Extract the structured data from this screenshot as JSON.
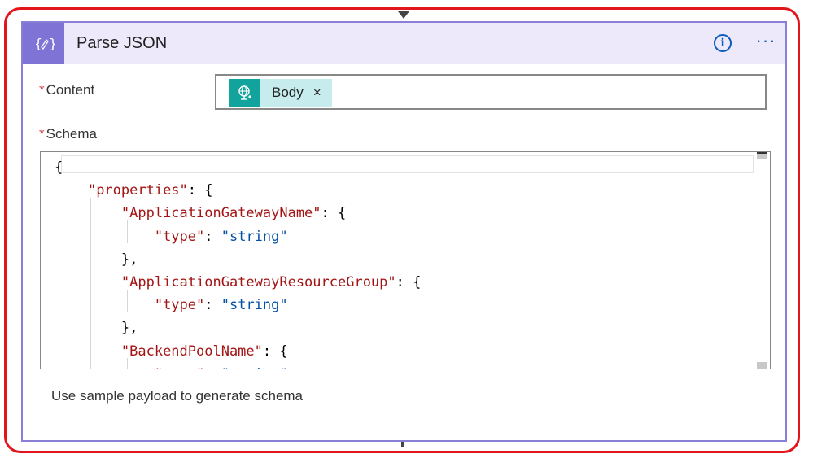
{
  "action": {
    "title": "Parse JSON",
    "icon": "expression-braces-icon",
    "info_icon": "info-icon",
    "more_icon": "more-options-icon",
    "more_label": "···",
    "info_label": "i"
  },
  "fields": {
    "content": {
      "required_mark": "*",
      "label": "Content",
      "token": {
        "label": "Body",
        "icon": "http-globe-icon",
        "remove_label": "×"
      }
    },
    "schema": {
      "required_mark": "*",
      "label": "Schema",
      "lines": [
        [
          {
            "t": "punc",
            "v": "{"
          }
        ],
        [
          {
            "t": "ws",
            "v": "    "
          },
          {
            "t": "key",
            "v": "\"properties\""
          },
          {
            "t": "punc",
            "v": ": {"
          }
        ],
        [
          {
            "t": "ws",
            "v": "        "
          },
          {
            "t": "key",
            "v": "\"ApplicationGatewayName\""
          },
          {
            "t": "punc",
            "v": ": {"
          }
        ],
        [
          {
            "t": "ws",
            "v": "            "
          },
          {
            "t": "key",
            "v": "\"type\""
          },
          {
            "t": "punc",
            "v": ": "
          },
          {
            "t": "str",
            "v": "\"string\""
          }
        ],
        [
          {
            "t": "ws",
            "v": "        "
          },
          {
            "t": "punc",
            "v": "},"
          }
        ],
        [
          {
            "t": "ws",
            "v": "        "
          },
          {
            "t": "key",
            "v": "\"ApplicationGatewayResourceGroup\""
          },
          {
            "t": "punc",
            "v": ": {"
          }
        ],
        [
          {
            "t": "ws",
            "v": "            "
          },
          {
            "t": "key",
            "v": "\"type\""
          },
          {
            "t": "punc",
            "v": ": "
          },
          {
            "t": "str",
            "v": "\"string\""
          }
        ],
        [
          {
            "t": "ws",
            "v": "        "
          },
          {
            "t": "punc",
            "v": "},"
          }
        ],
        [
          {
            "t": "ws",
            "v": "        "
          },
          {
            "t": "key",
            "v": "\"BackendPoolName\""
          },
          {
            "t": "punc",
            "v": ": {"
          }
        ],
        [
          {
            "t": "ws",
            "v": "            "
          },
          {
            "t": "key",
            "v": "\"type\""
          },
          {
            "t": "punc",
            "v": ": "
          },
          {
            "t": "str",
            "v": "\"string\""
          }
        ]
      ]
    }
  },
  "links": {
    "sample_payload": "Use sample payload to generate schema"
  },
  "colors": {
    "highlight": "#e3151a",
    "card_border": "#8a7fd6",
    "header_bg": "#ede9fb",
    "icon_bg": "#7f74d6",
    "token_bg": "#c7ecee",
    "token_icon_bg": "#12a39c",
    "json_key": "#a31515",
    "json_string": "#0451a5",
    "accent": "#0b5cbc"
  }
}
